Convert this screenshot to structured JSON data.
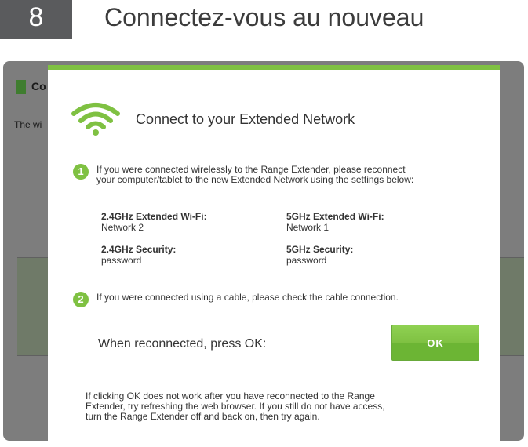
{
  "step": {
    "number": "8",
    "title": "Connectez-vous au nouveau"
  },
  "background_page": {
    "title_fragment": "Co",
    "text_fragment": "The wi"
  },
  "dialog": {
    "title": "Connect to your Extended Network",
    "step1": {
      "number": "1",
      "line1": "If you were connected wirelessly to the Range Extender, please reconnect",
      "line2": "your computer/tablet to the new Extended Network using the settings below:"
    },
    "settings": {
      "wifi24_label": "2.4GHz Extended Wi-Fi:",
      "wifi24_value": "Network 2",
      "wifi5_label": "5GHz Extended Wi-Fi:",
      "wifi5_value": "Network 1",
      "sec24_label": "2.4GHz Security:",
      "sec24_value": "password",
      "sec5_label": "5GHz Security:",
      "sec5_value": "password"
    },
    "step2": {
      "number": "2",
      "text": "If you were connected using a cable, please check the cable connection."
    },
    "reconnect_label": "When reconnected, press OK:",
    "ok_label": "OK",
    "footer": {
      "line1": "If clicking OK does not work after you have reconnected to the Range",
      "line2": "Extender, try refreshing the web browser. If you still do not have access,",
      "line3": "turn the Range Extender off and back on, then try again."
    },
    "accent_color": "#7fc142",
    "icons": [
      "wifi-icon",
      "number-1-icon",
      "number-2-icon"
    ]
  }
}
